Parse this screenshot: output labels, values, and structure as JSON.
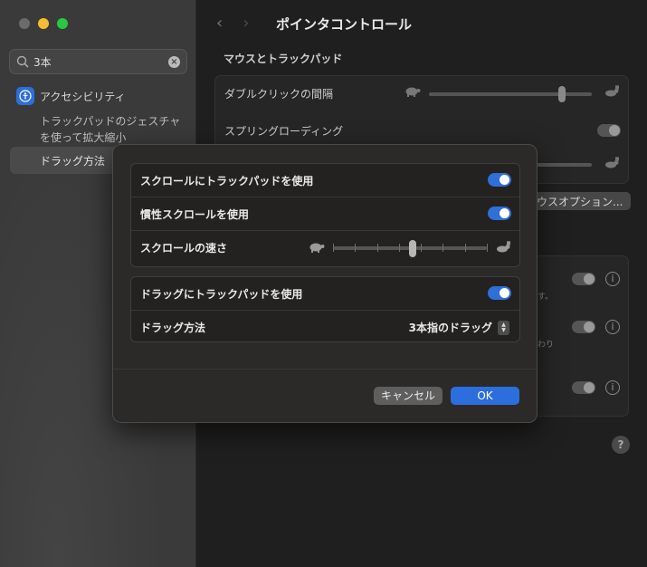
{
  "window": {
    "page_title": "ポインタコントロール"
  },
  "sidebar": {
    "search_value": "3本",
    "category_label": "アクセシビリティ",
    "sub_item_label": "トラックパッドのジェスチャを使って拡大縮小",
    "selected_item_label": "ドラッグ方法"
  },
  "background": {
    "section_title": "マウスとトラックパッド",
    "double_click_label": "ダブルクリックの間隔",
    "spring_loading_label": "スプリングローディング",
    "options_button_label": "ウスオプション...",
    "note_1": "す。",
    "note_2": "わり"
  },
  "sheet": {
    "scroll_with_trackpad_label": "スクロールにトラックパッドを使用",
    "scroll_with_trackpad_on": true,
    "inertia_scroll_label": "慣性スクロールを使用",
    "inertia_scroll_on": true,
    "scroll_speed_label": "スクロールの速さ",
    "scroll_speed_level": 0.52,
    "drag_with_trackpad_label": "ドラッグにトラックパッドを使用",
    "drag_with_trackpad_on": true,
    "drag_method_label": "ドラッグ方法",
    "drag_method_value": "3本指のドラッグ",
    "cancel_label": "キャンセル",
    "ok_label": "OK"
  },
  "colors": {
    "accent": "#2c6fdc",
    "sheet_bg": "#2b2a29",
    "sidebar_bg": "#3a3a3a"
  }
}
